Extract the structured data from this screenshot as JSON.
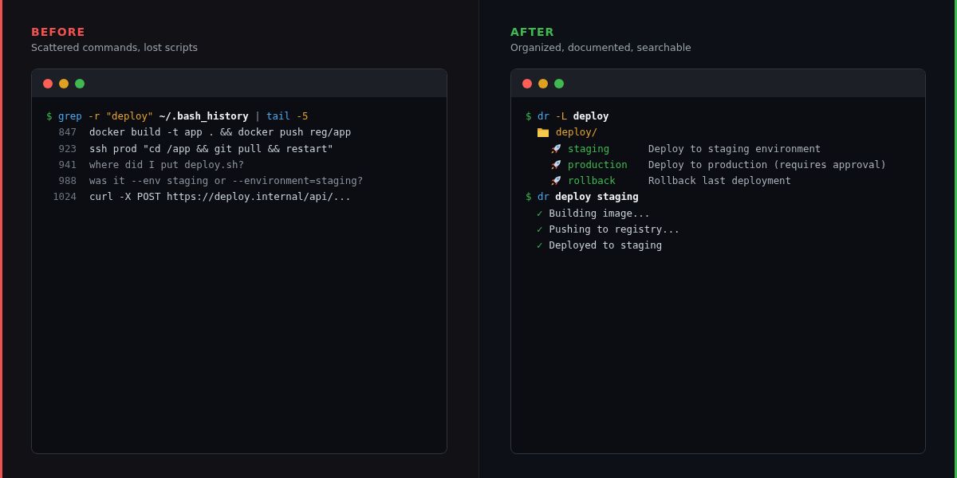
{
  "panels": [
    {
      "kind": "before",
      "title": "BEFORE",
      "subtitle": "Scattered commands, lost scripts",
      "lines": [
        {
          "kind": "command",
          "tokens": [
            {
              "text": "$",
              "kind": "prompt"
            },
            {
              "text": "grep",
              "kind": "cmd"
            },
            {
              "text": "-r",
              "kind": "flag"
            },
            {
              "text": "\"deploy\"",
              "kind": "flag"
            },
            {
              "text": "~/.bash_history",
              "kind": "arg"
            },
            {
              "text": "|",
              "kind": "pipe"
            },
            {
              "text": "tail",
              "kind": "cmd"
            },
            {
              "text": "-5",
              "kind": "flag"
            }
          ]
        },
        {
          "kind": "history",
          "number": "847",
          "text": "docker build -t app . && docker push reg/app",
          "faded": false
        },
        {
          "kind": "history",
          "number": "923",
          "text": "ssh prod \"cd /app && git pull && restart\"",
          "faded": false
        },
        {
          "kind": "history",
          "number": "941",
          "text": "where did I put deploy.sh?",
          "faded": true
        },
        {
          "kind": "history",
          "number": "988",
          "text": "was it --env staging or --environment=staging?",
          "faded": true
        },
        {
          "kind": "history",
          "number": "1024",
          "text": "curl -X POST https://deploy.internal/api/...",
          "faded": false
        }
      ]
    },
    {
      "kind": "after",
      "title": "AFTER",
      "subtitle": "Organized, documented, searchable",
      "lines": [
        {
          "kind": "command",
          "tokens": [
            {
              "text": "$",
              "kind": "prompt"
            },
            {
              "text": "dr",
              "kind": "cmd"
            },
            {
              "text": "-L",
              "kind": "flag"
            },
            {
              "text": "deploy",
              "kind": "arg"
            }
          ]
        },
        {
          "kind": "folder",
          "text": "deploy/"
        },
        {
          "kind": "script",
          "name": "staging",
          "description": "Deploy to staging environment"
        },
        {
          "kind": "script",
          "name": "production",
          "description": "Deploy to production (requires approval)"
        },
        {
          "kind": "script",
          "name": "rollback",
          "description": "Rollback last deployment"
        },
        {
          "kind": "command",
          "tokens": [
            {
              "text": "$",
              "kind": "prompt"
            },
            {
              "text": "dr",
              "kind": "cmd"
            },
            {
              "text": "deploy",
              "kind": "arg"
            },
            {
              "text": "staging",
              "kind": "arg"
            }
          ]
        },
        {
          "kind": "progress",
          "mark": "✓",
          "text": "Building image..."
        },
        {
          "kind": "progress",
          "mark": "✓",
          "text": "Pushing to registry..."
        },
        {
          "kind": "progress",
          "mark": "✓",
          "text": "Deployed to staging"
        }
      ]
    }
  ]
}
